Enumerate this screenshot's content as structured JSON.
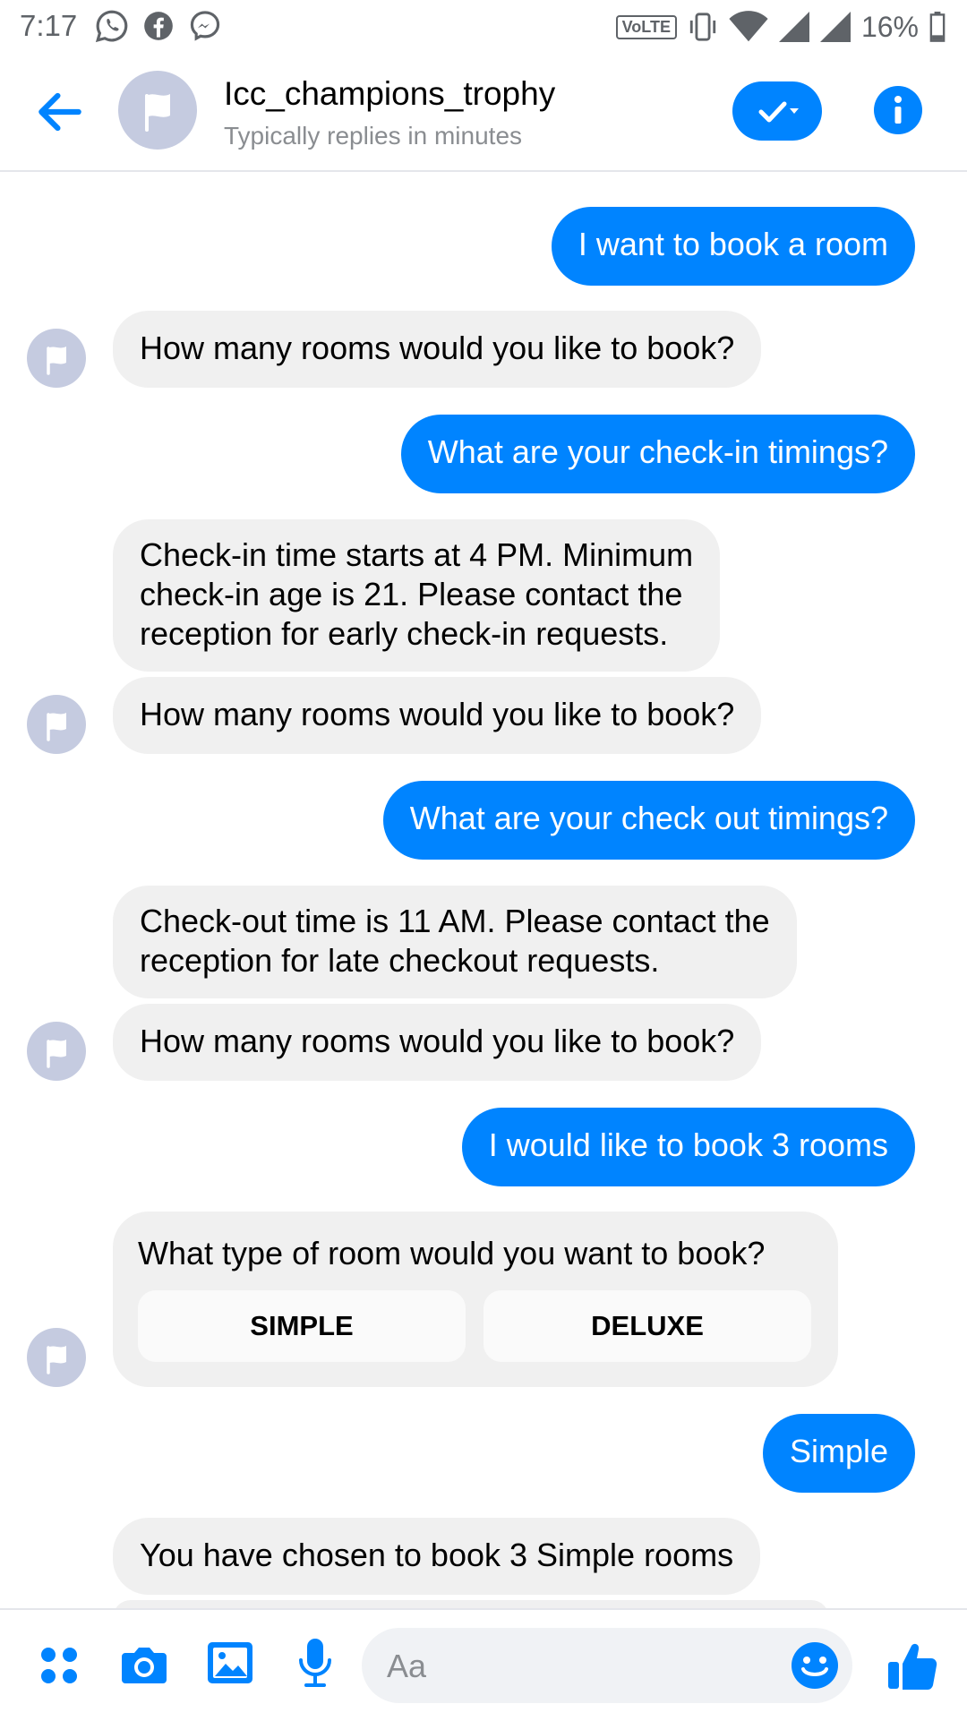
{
  "status_bar": {
    "time": "7:17",
    "network_badge": "VoLTE",
    "battery": "16%"
  },
  "header": {
    "title": "Icc_champions_trophy",
    "subtitle": "Typically replies in minutes"
  },
  "messages": [
    {
      "from": "user",
      "text": "I want to book a room"
    },
    {
      "from": "bot",
      "text": "How many rooms would you like to book?"
    },
    {
      "from": "user",
      "text": "What are your check-in timings?"
    },
    {
      "from": "bot",
      "lines": [
        "Check-in time starts at 4 PM. Minimum",
        "check-in age is 21. Please contact the",
        "reception for early check-in requests."
      ]
    },
    {
      "from": "bot",
      "text": "How many rooms would you like to book?"
    },
    {
      "from": "user",
      "text": "What are your check out timings?"
    },
    {
      "from": "bot",
      "lines": [
        "Check-out time is 11 AM. Please contact the",
        "reception for late checkout requests."
      ]
    },
    {
      "from": "bot",
      "text": "How many rooms would you like to book?"
    },
    {
      "from": "user",
      "text": "I would like to book 3 rooms"
    },
    {
      "from": "bot",
      "text": "What type of room would you want to book?",
      "options": [
        "SIMPLE",
        "DELUXE"
      ]
    },
    {
      "from": "user",
      "text": "Simple"
    },
    {
      "from": "bot",
      "text": "You have chosen to book 3 Simple rooms"
    }
  ],
  "composer": {
    "placeholder": "Aa"
  },
  "colors": {
    "accent": "#0084ff",
    "incoming_bubble": "#f0f0f0",
    "avatar": "#c5cbe0"
  }
}
